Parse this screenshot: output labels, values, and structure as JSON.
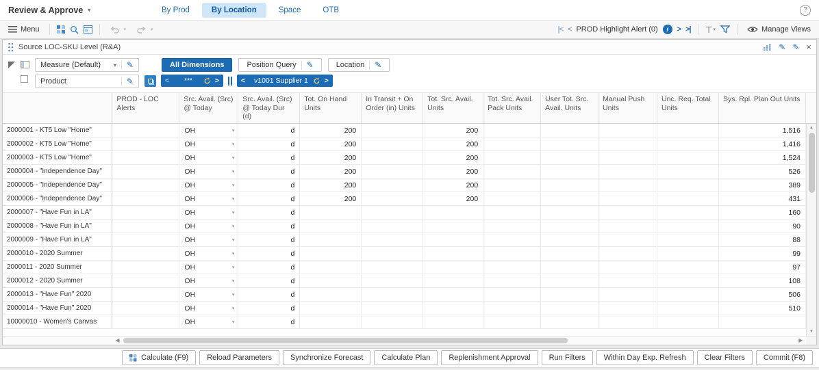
{
  "colors": {
    "accent": "#1b6cb5",
    "tab_active_bg": "#cfe6f8",
    "refresh": "#f3d573"
  },
  "header": {
    "title": "Review & Approve",
    "tabs": [
      {
        "label": "By Prod",
        "active": false
      },
      {
        "label": "By Location",
        "active": true
      },
      {
        "label": "Space",
        "active": false
      },
      {
        "label": "OTB",
        "active": false
      }
    ],
    "help": "?"
  },
  "toolbar": {
    "menu": "Menu",
    "alert_nav": "PROD Highlight Alert (0)",
    "manage_views": "Manage Views"
  },
  "panel": {
    "title": "Source LOC-SKU Level (R&A)"
  },
  "dimensions": {
    "measure": "Measure (Default)",
    "product": "Product",
    "chips": [
      {
        "label": "All Dimensions",
        "active": true,
        "editable": false
      },
      {
        "label": "Position Query",
        "active": false,
        "editable": true
      },
      {
        "label": "Location",
        "active": false,
        "editable": true
      }
    ],
    "pagers": [
      {
        "value": "***"
      },
      {
        "value": "v1001 Supplier 1"
      }
    ]
  },
  "table": {
    "columns": [
      "PROD - LOC Alerts",
      "Src. Avail. (Src) @ Today",
      "Src. Avail. (Src) @ Today Dur (d)",
      "Tot. On Hand Units",
      "In Transit + On Order (in) Units",
      "Tot. Src. Avail. Units",
      "Tot. Src. Avail. Pack Units",
      "User Tot. Src. Avail. Units",
      "Manual Push Units",
      "Unc. Req. Total Units",
      "Sys. Rpl. Plan Out Units"
    ],
    "rows": [
      {
        "label": "2000001 - KT5 Low \"Home\"",
        "cells": [
          "",
          "OH",
          "d",
          "200",
          "",
          "200",
          "",
          "",
          "",
          "",
          "1,516"
        ]
      },
      {
        "label": "2000002 - KT5 Low \"Home\"",
        "cells": [
          "",
          "OH",
          "d",
          "200",
          "",
          "200",
          "",
          "",
          "",
          "",
          "1,416"
        ]
      },
      {
        "label": "2000003 - KT5 Low \"Home\"",
        "cells": [
          "",
          "OH",
          "d",
          "200",
          "",
          "200",
          "",
          "",
          "",
          "",
          "1,524"
        ]
      },
      {
        "label": "2000004 - \"Independence Day\"",
        "cells": [
          "",
          "OH",
          "d",
          "200",
          "",
          "200",
          "",
          "",
          "",
          "",
          "526"
        ]
      },
      {
        "label": "2000005 - \"Independence Day\"",
        "cells": [
          "",
          "OH",
          "d",
          "200",
          "",
          "200",
          "",
          "",
          "",
          "",
          "389"
        ]
      },
      {
        "label": "2000006 - \"Independence Day\"",
        "cells": [
          "",
          "OH",
          "d",
          "200",
          "",
          "200",
          "",
          "",
          "",
          "",
          "431"
        ]
      },
      {
        "label": "2000007 - \"Have Fun in LA\"",
        "cells": [
          "",
          "OH",
          "d",
          "",
          "",
          "",
          "",
          "",
          "",
          "",
          "160"
        ]
      },
      {
        "label": "2000008 - \"Have Fun in LA\"",
        "cells": [
          "",
          "OH",
          "d",
          "",
          "",
          "",
          "",
          "",
          "",
          "",
          "90"
        ]
      },
      {
        "label": "2000009 - \"Have Fun in LA\"",
        "cells": [
          "",
          "OH",
          "d",
          "",
          "",
          "",
          "",
          "",
          "",
          "",
          "88"
        ]
      },
      {
        "label": "2000010 - 2020 Summer",
        "cells": [
          "",
          "OH",
          "d",
          "",
          "",
          "",
          "",
          "",
          "",
          "",
          "99"
        ]
      },
      {
        "label": "2000011 - 2020 Summer",
        "cells": [
          "",
          "OH",
          "d",
          "",
          "",
          "",
          "",
          "",
          "",
          "",
          "97"
        ]
      },
      {
        "label": "2000012 - 2020 Summer",
        "cells": [
          "",
          "OH",
          "d",
          "",
          "",
          "",
          "",
          "",
          "",
          "",
          "108"
        ]
      },
      {
        "label": "2000013 - \"Have Fun\" 2020",
        "cells": [
          "",
          "OH",
          "d",
          "",
          "",
          "",
          "",
          "",
          "",
          "",
          "506"
        ]
      },
      {
        "label": "2000014 - \"Have Fun\" 2020",
        "cells": [
          "",
          "OH",
          "d",
          "",
          "",
          "",
          "",
          "",
          "",
          "",
          "510"
        ]
      },
      {
        "label": "10000010 - Women's Canvas",
        "cells": [
          "",
          "OH",
          "d",
          "",
          "",
          "",
          "",
          "",
          "",
          "",
          ""
        ]
      }
    ]
  },
  "footer": {
    "buttons": [
      {
        "label": "Calculate (F9)",
        "icon": "grid"
      },
      {
        "label": "Reload Parameters"
      },
      {
        "label": "Synchronize Forecast"
      },
      {
        "label": "Calculate Plan"
      },
      {
        "label": "Replenishment Approval"
      },
      {
        "label": "Run Filters"
      },
      {
        "label": "Within Day Exp. Refresh"
      },
      {
        "label": "Clear Filters"
      },
      {
        "label": "Commit (F8)"
      }
    ]
  }
}
